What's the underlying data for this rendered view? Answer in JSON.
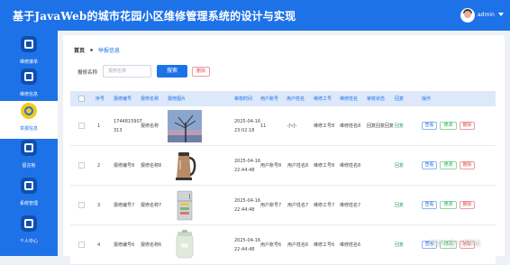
{
  "header": {
    "title": "基于JavaWeb的城市花园小区维修管理系统的设计与实现",
    "username": "admin",
    "colors": {
      "brand": "#1e72e8",
      "accent": "#f6c81a"
    }
  },
  "sidebar": {
    "items": [
      {
        "label": "维修接单",
        "icon": "wrench-icon",
        "active": false
      },
      {
        "label": "维修信息",
        "icon": "grid-icon",
        "active": false
      },
      {
        "label": "举报信息",
        "icon": "bulb-icon",
        "active": true
      },
      {
        "label": "留言板",
        "icon": "clipboard-icon",
        "active": false
      },
      {
        "label": "系统管理",
        "icon": "server-icon",
        "active": false
      },
      {
        "label": "个人中心",
        "icon": "window-icon",
        "active": false
      }
    ]
  },
  "breadcrumb": {
    "home": "首页",
    "current": "举报信息"
  },
  "search": {
    "label": "报修名称",
    "placeholder": "报修名称",
    "button": "搜索",
    "delete": "删除"
  },
  "table": {
    "headers": [
      "序号",
      "报修编号",
      "报修名称",
      "报修图片",
      "审核时间",
      "用户账号",
      "用户姓名",
      "维修工号",
      "维修姓名",
      "审核状态",
      "回复",
      "操作"
    ],
    "actions": {
      "view": "查看",
      "edit": "修改",
      "delete": "删除"
    },
    "rows": [
      {
        "index": "1",
        "code_line1": "1744815907",
        "code_line2": "313",
        "name": "报修名称",
        "image": "tree-photo",
        "time_line1": "2025-04-16",
        "time_line2": "23:02:18",
        "account": "11",
        "user_name": "小小",
        "worker_id": "维修工号8",
        "worker_name": "维修姓名8",
        "audit": "回复回复回复",
        "reply": "回复"
      },
      {
        "index": "2",
        "code_line1": "报修编号8",
        "code_line2": "",
        "name": "报修名称8",
        "image": "kettle-photo",
        "time_line1": "2025-04-16",
        "time_line2": "22:44:48",
        "account": "用户账号8",
        "user_name": "用户姓名8",
        "worker_id": "维修工号8",
        "worker_name": "维修姓名8",
        "audit": "",
        "reply": "回复"
      },
      {
        "index": "3",
        "code_line1": "报修编号7",
        "code_line2": "",
        "name": "报修名称7",
        "image": "fridge-photo",
        "time_line1": "2025-04-16",
        "time_line2": "22:44:48",
        "account": "用户账号7",
        "user_name": "用户姓名7",
        "worker_id": "维修工号7",
        "worker_name": "维修姓名7",
        "audit": "",
        "reply": "回复"
      },
      {
        "index": "4",
        "code_line1": "报修编号6",
        "code_line2": "",
        "name": "报修名称6",
        "image": "pot-photo",
        "time_line1": "2025-04-16",
        "time_line2": "22:44:48",
        "account": "用户账号6",
        "user_name": "用户姓名6",
        "worker_id": "维修工号6",
        "worker_name": "维修姓名6",
        "audit": "",
        "reply": "回复"
      }
    ]
  },
  "watermark": "CSDN @一点毕设"
}
